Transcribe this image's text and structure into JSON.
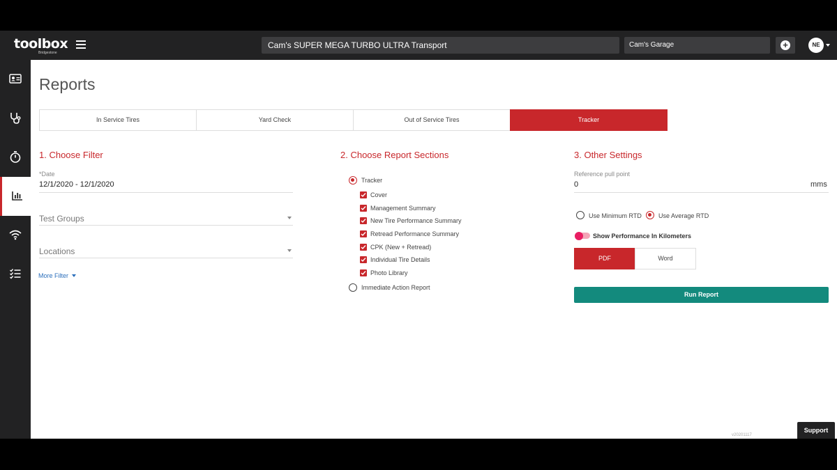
{
  "header": {
    "logo": "toolbox",
    "logo_sub": "Bridgestone",
    "fleet": "Cam's SUPER MEGA TURBO ULTRA Transport",
    "garage": "Cam's Garage",
    "avatar": "NE"
  },
  "sidebar": {
    "items": [
      {
        "icon": "id-card-icon"
      },
      {
        "icon": "stethoscope-icon"
      },
      {
        "icon": "stopwatch-icon"
      },
      {
        "icon": "bar-chart-icon",
        "active": true
      },
      {
        "icon": "wifi-icon"
      },
      {
        "icon": "checklist-icon"
      }
    ]
  },
  "page": {
    "title": "Reports",
    "tabs": [
      "In Service Tires",
      "Yard Check",
      "Out of Service Tires",
      "Tracker"
    ],
    "active_tab": "Tracker"
  },
  "filter": {
    "title": "1. Choose Filter",
    "date_label": "*Date",
    "date_value": "12/1/2020 - 12/1/2020",
    "test_groups": "Test Groups",
    "locations": "Locations",
    "more_filter": "More Filter"
  },
  "sections": {
    "title": "2. Choose Report Sections",
    "tracker": "Tracker",
    "items": [
      "Cover",
      "Management Summary",
      "New Tire Performance Summary",
      "Retread Performance Summary",
      "CPK (New + Retread)",
      "Individual Tire Details",
      "Photo Library"
    ],
    "immediate": "Immediate Action Report"
  },
  "settings": {
    "title": "3. Other Settings",
    "ref_label": "Reference pull point",
    "ref_value": "0",
    "ref_unit": "mms",
    "min_rtd": "Use Minimum RTD",
    "avg_rtd": "Use Average RTD",
    "toggle_label": "Show Performance In Kilometers",
    "pdf": "PDF",
    "word": "Word",
    "run": "Run Report"
  },
  "footer": {
    "version": "v20201117",
    "support": "Support"
  },
  "colors": {
    "accent": "#c8272b",
    "teal": "#138a7d",
    "dark": "#222223",
    "toggle": "#e91e63"
  }
}
